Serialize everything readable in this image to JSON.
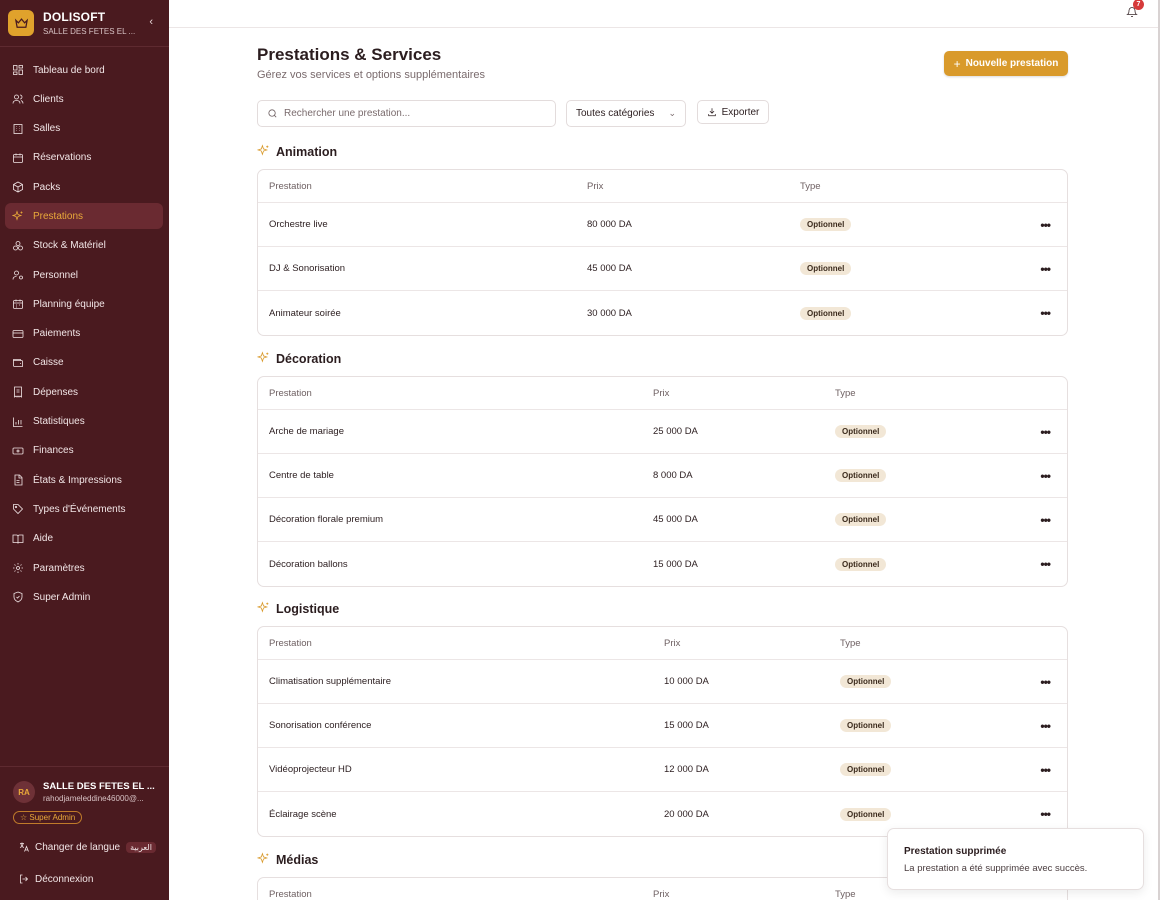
{
  "brand": {
    "name": "DOLISOFT",
    "subtitle": "SALLE DES FETES EL ...",
    "collapse_icon": "chevron-left-icon",
    "logo_icon": "crown-icon",
    "accent": "#e0a22c"
  },
  "sidebar": {
    "background": "#4a1a1f",
    "items": [
      {
        "label": "Tableau de bord",
        "icon": "dashboard-icon"
      },
      {
        "label": "Clients",
        "icon": "users-icon"
      },
      {
        "label": "Salles",
        "icon": "building-icon"
      },
      {
        "label": "Réservations",
        "icon": "calendar-icon"
      },
      {
        "label": "Packs",
        "icon": "package-icon"
      },
      {
        "label": "Prestations",
        "icon": "sparkles-icon",
        "active": true
      },
      {
        "label": "Stock & Matériel",
        "icon": "boxes-icon"
      },
      {
        "label": "Personnel",
        "icon": "user-cog-icon"
      },
      {
        "label": "Planning équipe",
        "icon": "calendar-days-icon"
      },
      {
        "label": "Paiements",
        "icon": "credit-card-icon"
      },
      {
        "label": "Caisse",
        "icon": "wallet-icon"
      },
      {
        "label": "Dépenses",
        "icon": "receipt-icon"
      },
      {
        "label": "Statistiques",
        "icon": "bar-chart-icon"
      },
      {
        "label": "Finances",
        "icon": "banknote-icon"
      },
      {
        "label": "États & Impressions",
        "icon": "file-text-icon"
      },
      {
        "label": "Types d'Événements",
        "icon": "tag-icon"
      },
      {
        "label": "Aide",
        "icon": "book-icon"
      },
      {
        "label": "Paramètres",
        "icon": "settings-icon"
      },
      {
        "label": "Super Admin",
        "icon": "shield-icon"
      }
    ],
    "user": {
      "initials": "RA",
      "name": "SALLE DES FETES EL ...",
      "email": "rahodjameleddine46000@...",
      "role": "☆ Super Admin"
    },
    "language": {
      "label": "Changer de langue",
      "badge": "العربية",
      "icon": "languages-icon"
    },
    "logout": {
      "label": "Déconnexion",
      "icon": "logout-icon"
    }
  },
  "topbar": {
    "notification_count": "7",
    "bell_icon": "bell-icon"
  },
  "page": {
    "title": "Prestations & Services",
    "subtitle": "Gérez vos services et options supplémentaires",
    "new_button": "Nouvelle prestation",
    "search_placeholder": "Rechercher une prestation...",
    "category_filter": "Toutes catégories",
    "export_button": "Exporter"
  },
  "columns": {
    "name": "Prestation",
    "price": "Prix",
    "type": "Type"
  },
  "sections": [
    {
      "title": "Animation",
      "rows": [
        {
          "name": "Orchestre live",
          "price": "80 000 DA",
          "type": "Optionnel"
        },
        {
          "name": "DJ & Sonorisation",
          "price": "45 000 DA",
          "type": "Optionnel"
        },
        {
          "name": "Animateur soirée",
          "price": "30 000 DA",
          "type": "Optionnel"
        }
      ]
    },
    {
      "title": "Décoration",
      "rows": [
        {
          "name": "Arche de mariage",
          "price": "25 000 DA",
          "type": "Optionnel"
        },
        {
          "name": "Centre de table",
          "price": "8 000 DA",
          "type": "Optionnel"
        },
        {
          "name": "Décoration florale premium",
          "price": "45 000 DA",
          "type": "Optionnel"
        },
        {
          "name": "Décoration ballons",
          "price": "15 000 DA",
          "type": "Optionnel"
        }
      ]
    },
    {
      "title": "Logistique",
      "rows": [
        {
          "name": "Climatisation supplémentaire",
          "price": "10 000 DA",
          "type": "Optionnel"
        },
        {
          "name": "Sonorisation conférence",
          "price": "15 000 DA",
          "type": "Optionnel"
        },
        {
          "name": "Vidéoprojecteur HD",
          "price": "12 000 DA",
          "type": "Optionnel"
        },
        {
          "name": "Éclairage scène",
          "price": "20 000 DA",
          "type": "Optionnel"
        }
      ]
    },
    {
      "title": "Médias",
      "rows": []
    }
  ],
  "toast": {
    "title": "Prestation supprimée",
    "message": "La prestation a été supprimée avec succès."
  }
}
